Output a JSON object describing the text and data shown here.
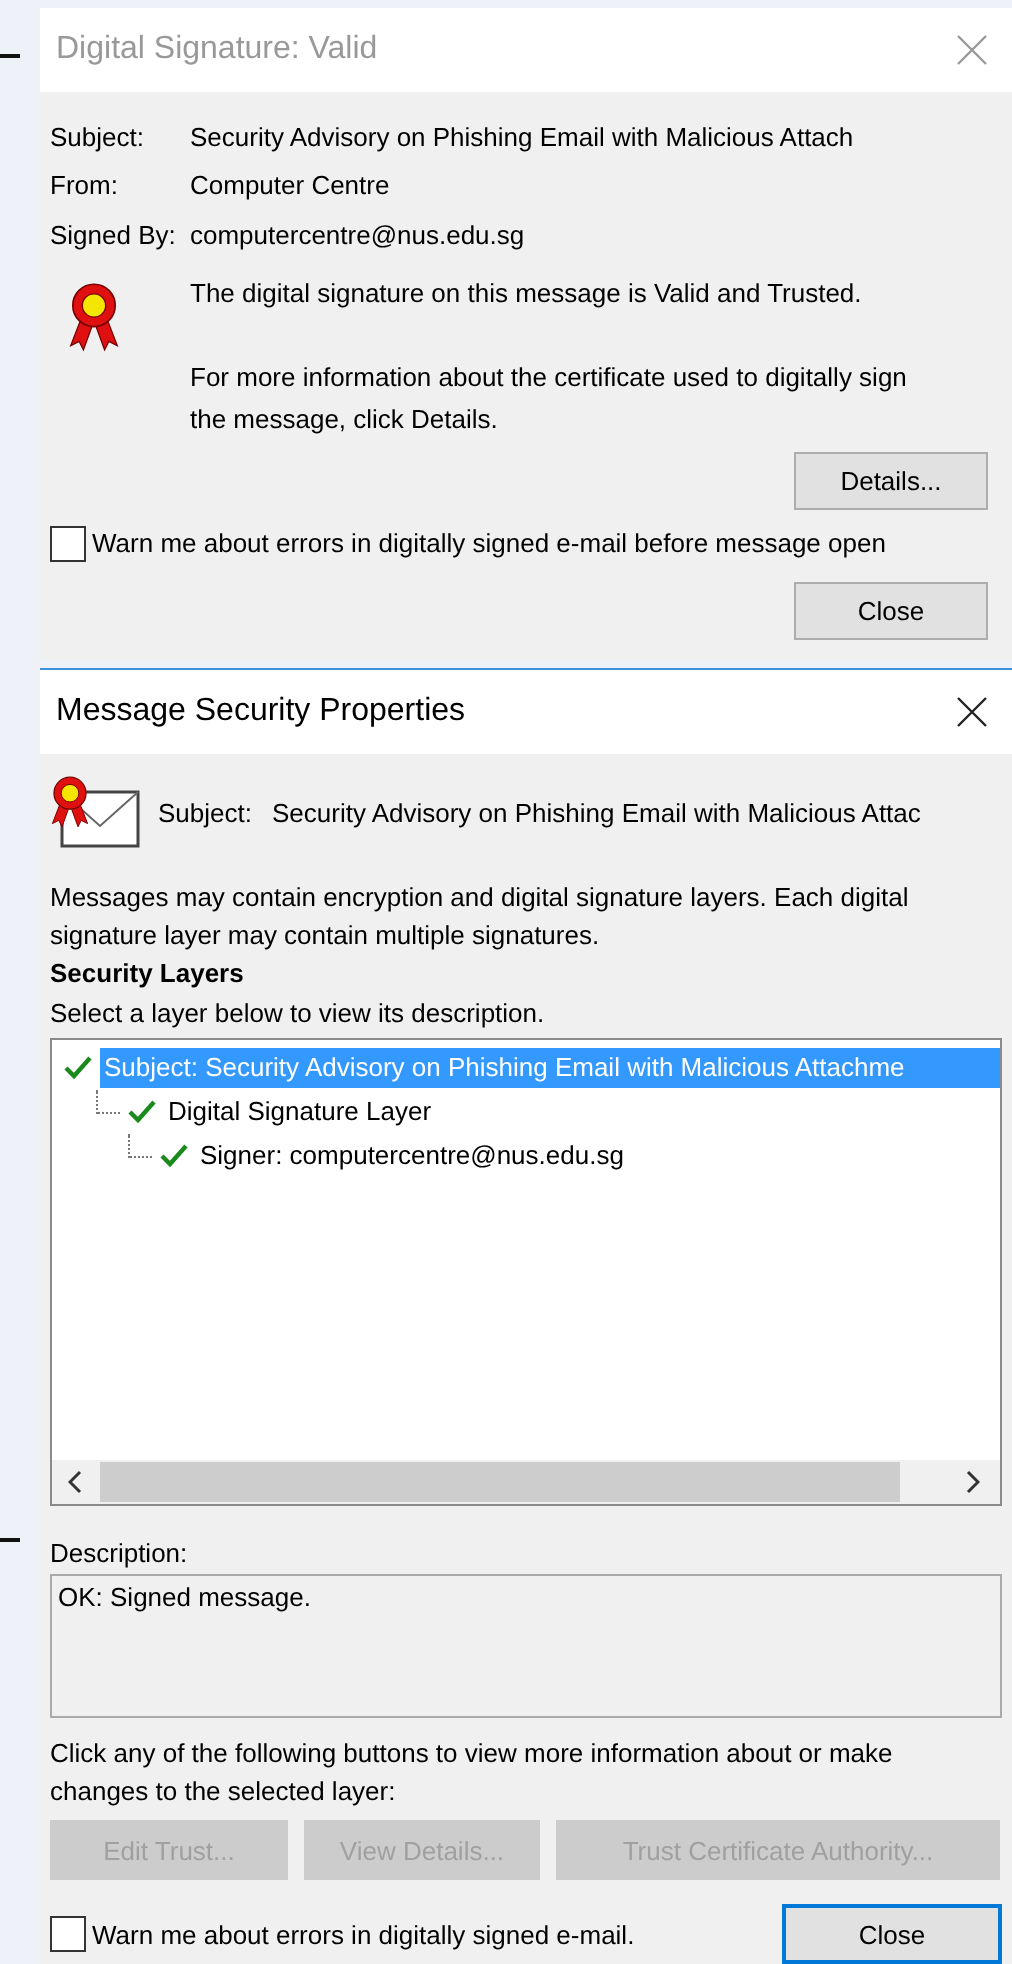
{
  "signature_dialog": {
    "title": "Digital Signature: Valid",
    "fields": [
      {
        "label": "Subject:",
        "value": "Security Advisory on Phishing Email with Malicious Attach"
      },
      {
        "label": "From:",
        "value": "Computer Centre"
      },
      {
        "label": "Signed By:",
        "value": "computercentre@nus.edu.sg"
      }
    ],
    "status": "The digital signature on this message is Valid and Trusted.",
    "info": "For more information about the certificate used to digitally sign the message, click Details.",
    "details_button": "Details...",
    "warn_checkbox": {
      "label": "Warn me about errors in digitally signed e-mail before message open",
      "checked": false
    },
    "close_button": "Close"
  },
  "properties_dialog": {
    "title": "Message Security Properties",
    "subject_label": "Subject:",
    "subject_value": "Security Advisory on Phishing Email with Malicious Attac",
    "intro": "Messages may contain encryption and digital signature layers. Each digital signature layer may contain multiple signatures.",
    "section_heading": "Security Layers",
    "tree_hint": "Select a layer below to view its description.",
    "layers": [
      {
        "label": "Subject: Security Advisory on Phishing Email with Malicious Attachme",
        "selected": true,
        "children": [
          {
            "label": "Digital Signature Layer",
            "selected": false,
            "children": [
              {
                "label": "Signer: computercentre@nus.edu.sg",
                "selected": false
              }
            ]
          }
        ]
      }
    ],
    "description_label": "Description:",
    "description": "OK: Signed message.",
    "buttons_hint": "Click any of the following buttons to view more information about or make changes to the selected layer:",
    "action_buttons": [
      {
        "label": "Edit Trust...",
        "disabled": true
      },
      {
        "label": "View Details...",
        "disabled": true
      },
      {
        "label": "Trust Certificate Authority...",
        "disabled": true
      }
    ],
    "warn_checkbox": {
      "label": "Warn me about errors in digitally signed e-mail.",
      "checked": false
    },
    "close_button": "Close"
  }
}
